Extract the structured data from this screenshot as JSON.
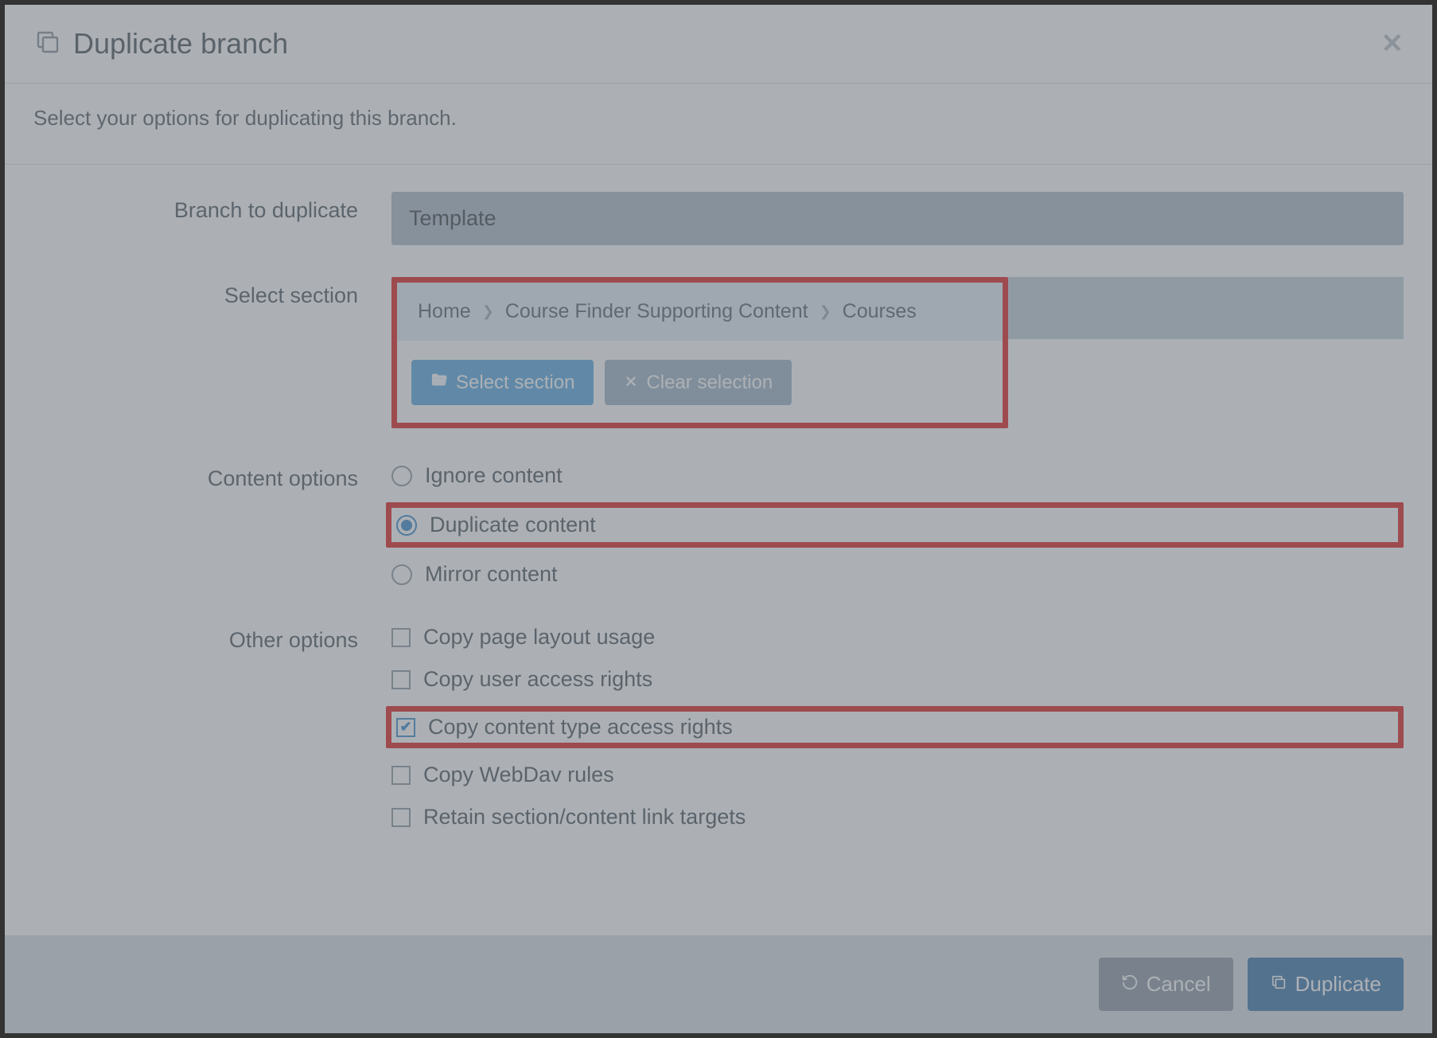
{
  "header": {
    "title": "Duplicate branch"
  },
  "subtitle": "Select your options for duplicating this branch.",
  "labels": {
    "branch": "Branch to duplicate",
    "section": "Select section",
    "content": "Content options",
    "other": "Other options"
  },
  "branch_value": "Template",
  "breadcrumb": {
    "a": "Home",
    "b": "Course Finder Supporting Content",
    "c": "Courses"
  },
  "buttons": {
    "select_section": "Select section",
    "clear_selection": "Clear selection",
    "cancel": "Cancel",
    "duplicate": "Duplicate"
  },
  "content_options": {
    "ignore": "Ignore content",
    "duplicate": "Duplicate content",
    "mirror": "Mirror content",
    "selected": "duplicate"
  },
  "other_options": {
    "copy_page_layout": {
      "label": "Copy page layout usage",
      "checked": false
    },
    "copy_user_access": {
      "label": "Copy user access rights",
      "checked": false
    },
    "copy_content_type": {
      "label": "Copy content type access rights",
      "checked": true
    },
    "copy_webdav": {
      "label": "Copy WebDav rules",
      "checked": false
    },
    "retain_targets": {
      "label": "Retain section/content link targets",
      "checked": false
    }
  }
}
